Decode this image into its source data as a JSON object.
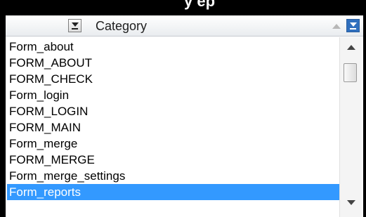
{
  "header": {
    "title": "Category",
    "partial_heading": "y    ep"
  },
  "list": {
    "items": [
      "Form_about",
      "FORM_ABOUT",
      "FORM_CHECK",
      "Form_login",
      "FORM_LOGIN",
      "FORM_MAIN",
      "Form_merge",
      "FORM_MERGE",
      "Form_merge_settings",
      "Form_reports"
    ],
    "selected_index": 9
  },
  "colors": {
    "selection": "#3399ff",
    "header_button_active": "#2f6fbe"
  }
}
